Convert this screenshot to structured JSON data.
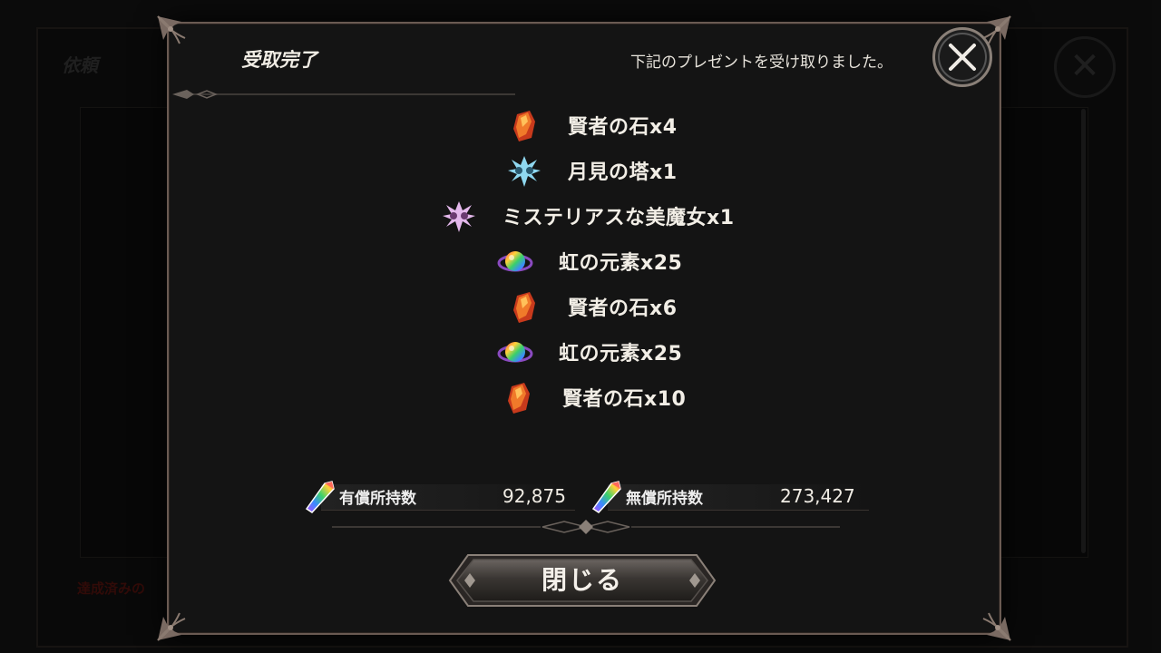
{
  "background": {
    "panel_title": "依頼",
    "footer_text": "達成済みの"
  },
  "dialog": {
    "title": "受取完了",
    "subtitle": "下記のプレゼントを受け取りました。",
    "close_icon": "close-x-icon",
    "items": [
      {
        "icon": "sage-stone-icon",
        "label": "賢者の石x4"
      },
      {
        "icon": "moon-tower-emblem-icon",
        "label": "月見の塔x1"
      },
      {
        "icon": "mysterious-witch-emblem-icon",
        "label": "ミステリアスな美魔女x1"
      },
      {
        "icon": "rainbow-element-orb-icon",
        "label": "虹の元素x25"
      },
      {
        "icon": "sage-stone-icon",
        "label": "賢者の石x6"
      },
      {
        "icon": "rainbow-element-orb-icon",
        "label": "虹の元素x25"
      },
      {
        "icon": "sage-stone-icon",
        "label": "賢者の石x10"
      }
    ],
    "paid": {
      "label": "有償所持数",
      "value": "92,875",
      "icon": "rainbow-crystal-icon"
    },
    "free": {
      "label": "無償所持数",
      "value": "273,427",
      "icon": "rainbow-crystal-icon"
    },
    "close_button_label": "閉じる"
  },
  "colors": {
    "frame": "#6a5a52",
    "panel": "#141414",
    "text": "#f2eee6",
    "stone": "#e0602a",
    "emblem_moon": "#8fd8f0",
    "emblem_witch": "#e4b8ec"
  }
}
